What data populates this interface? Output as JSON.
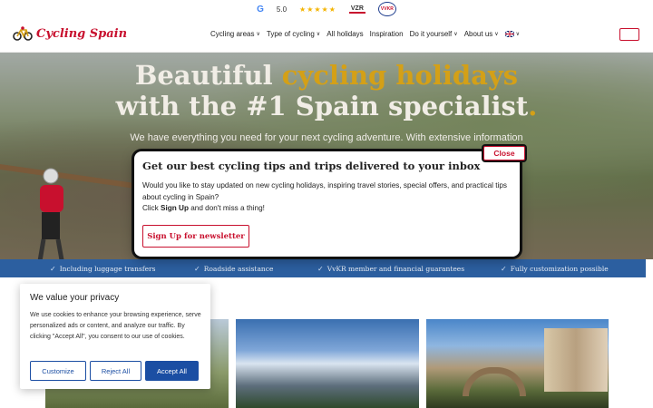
{
  "topbar": {
    "rating_value": "5.0",
    "google_logo": "G",
    "stars": "★★★★★",
    "badge_1": "VZR",
    "badge_2": "VVKR"
  },
  "header": {
    "logo_text": "Cycling Spain",
    "nav": [
      {
        "label": "Cycling areas",
        "has_dropdown": true
      },
      {
        "label": "Type of cycling",
        "has_dropdown": true
      },
      {
        "label": "All holidays",
        "has_dropdown": false
      },
      {
        "label": "Inspiration",
        "has_dropdown": false
      },
      {
        "label": "Do it yourself",
        "has_dropdown": true
      },
      {
        "label": "About us",
        "has_dropdown": true
      }
    ],
    "language_icon": "uk-flag-icon",
    "accent_color": "#c8102e"
  },
  "hero": {
    "title_part1": "Beautiful ",
    "title_highlight": "cycling holidays",
    "title_line2": "with the #1 Spain specialist",
    "title_dot": ".",
    "subtitle": "We have everything you need for your next cycling adventure. With extensive information",
    "highlight_color": "#d4a017"
  },
  "features": [
    "Including luggage transfers",
    "Roadside assistance",
    "VvKR member and financial guarantees",
    "Fully customization possible"
  ],
  "newsletter_modal": {
    "title": "Get our best cycling tips and trips delivered to your inbox",
    "body_line": "Would you like to stay updated on new cycling holidays, inspiring travel stories, special offers, and practical tips about cycling in Spain?",
    "click_prefix": "Click ",
    "click_bold": "Sign Up",
    "click_suffix": " and don't miss a thing!",
    "cta_label": "Sign Up for newsletter",
    "close_label": "Close"
  },
  "cookie_banner": {
    "title": "We value your privacy",
    "text": "We use cookies to enhance your browsing experience, serve personalized ads or content, and analyze our traffic. By clicking \"Accept All\", you consent to our use of cookies.",
    "customize_label": "Customize",
    "reject_label": "Reject All",
    "accept_label": "Accept All",
    "button_color": "#1b4ea3"
  }
}
